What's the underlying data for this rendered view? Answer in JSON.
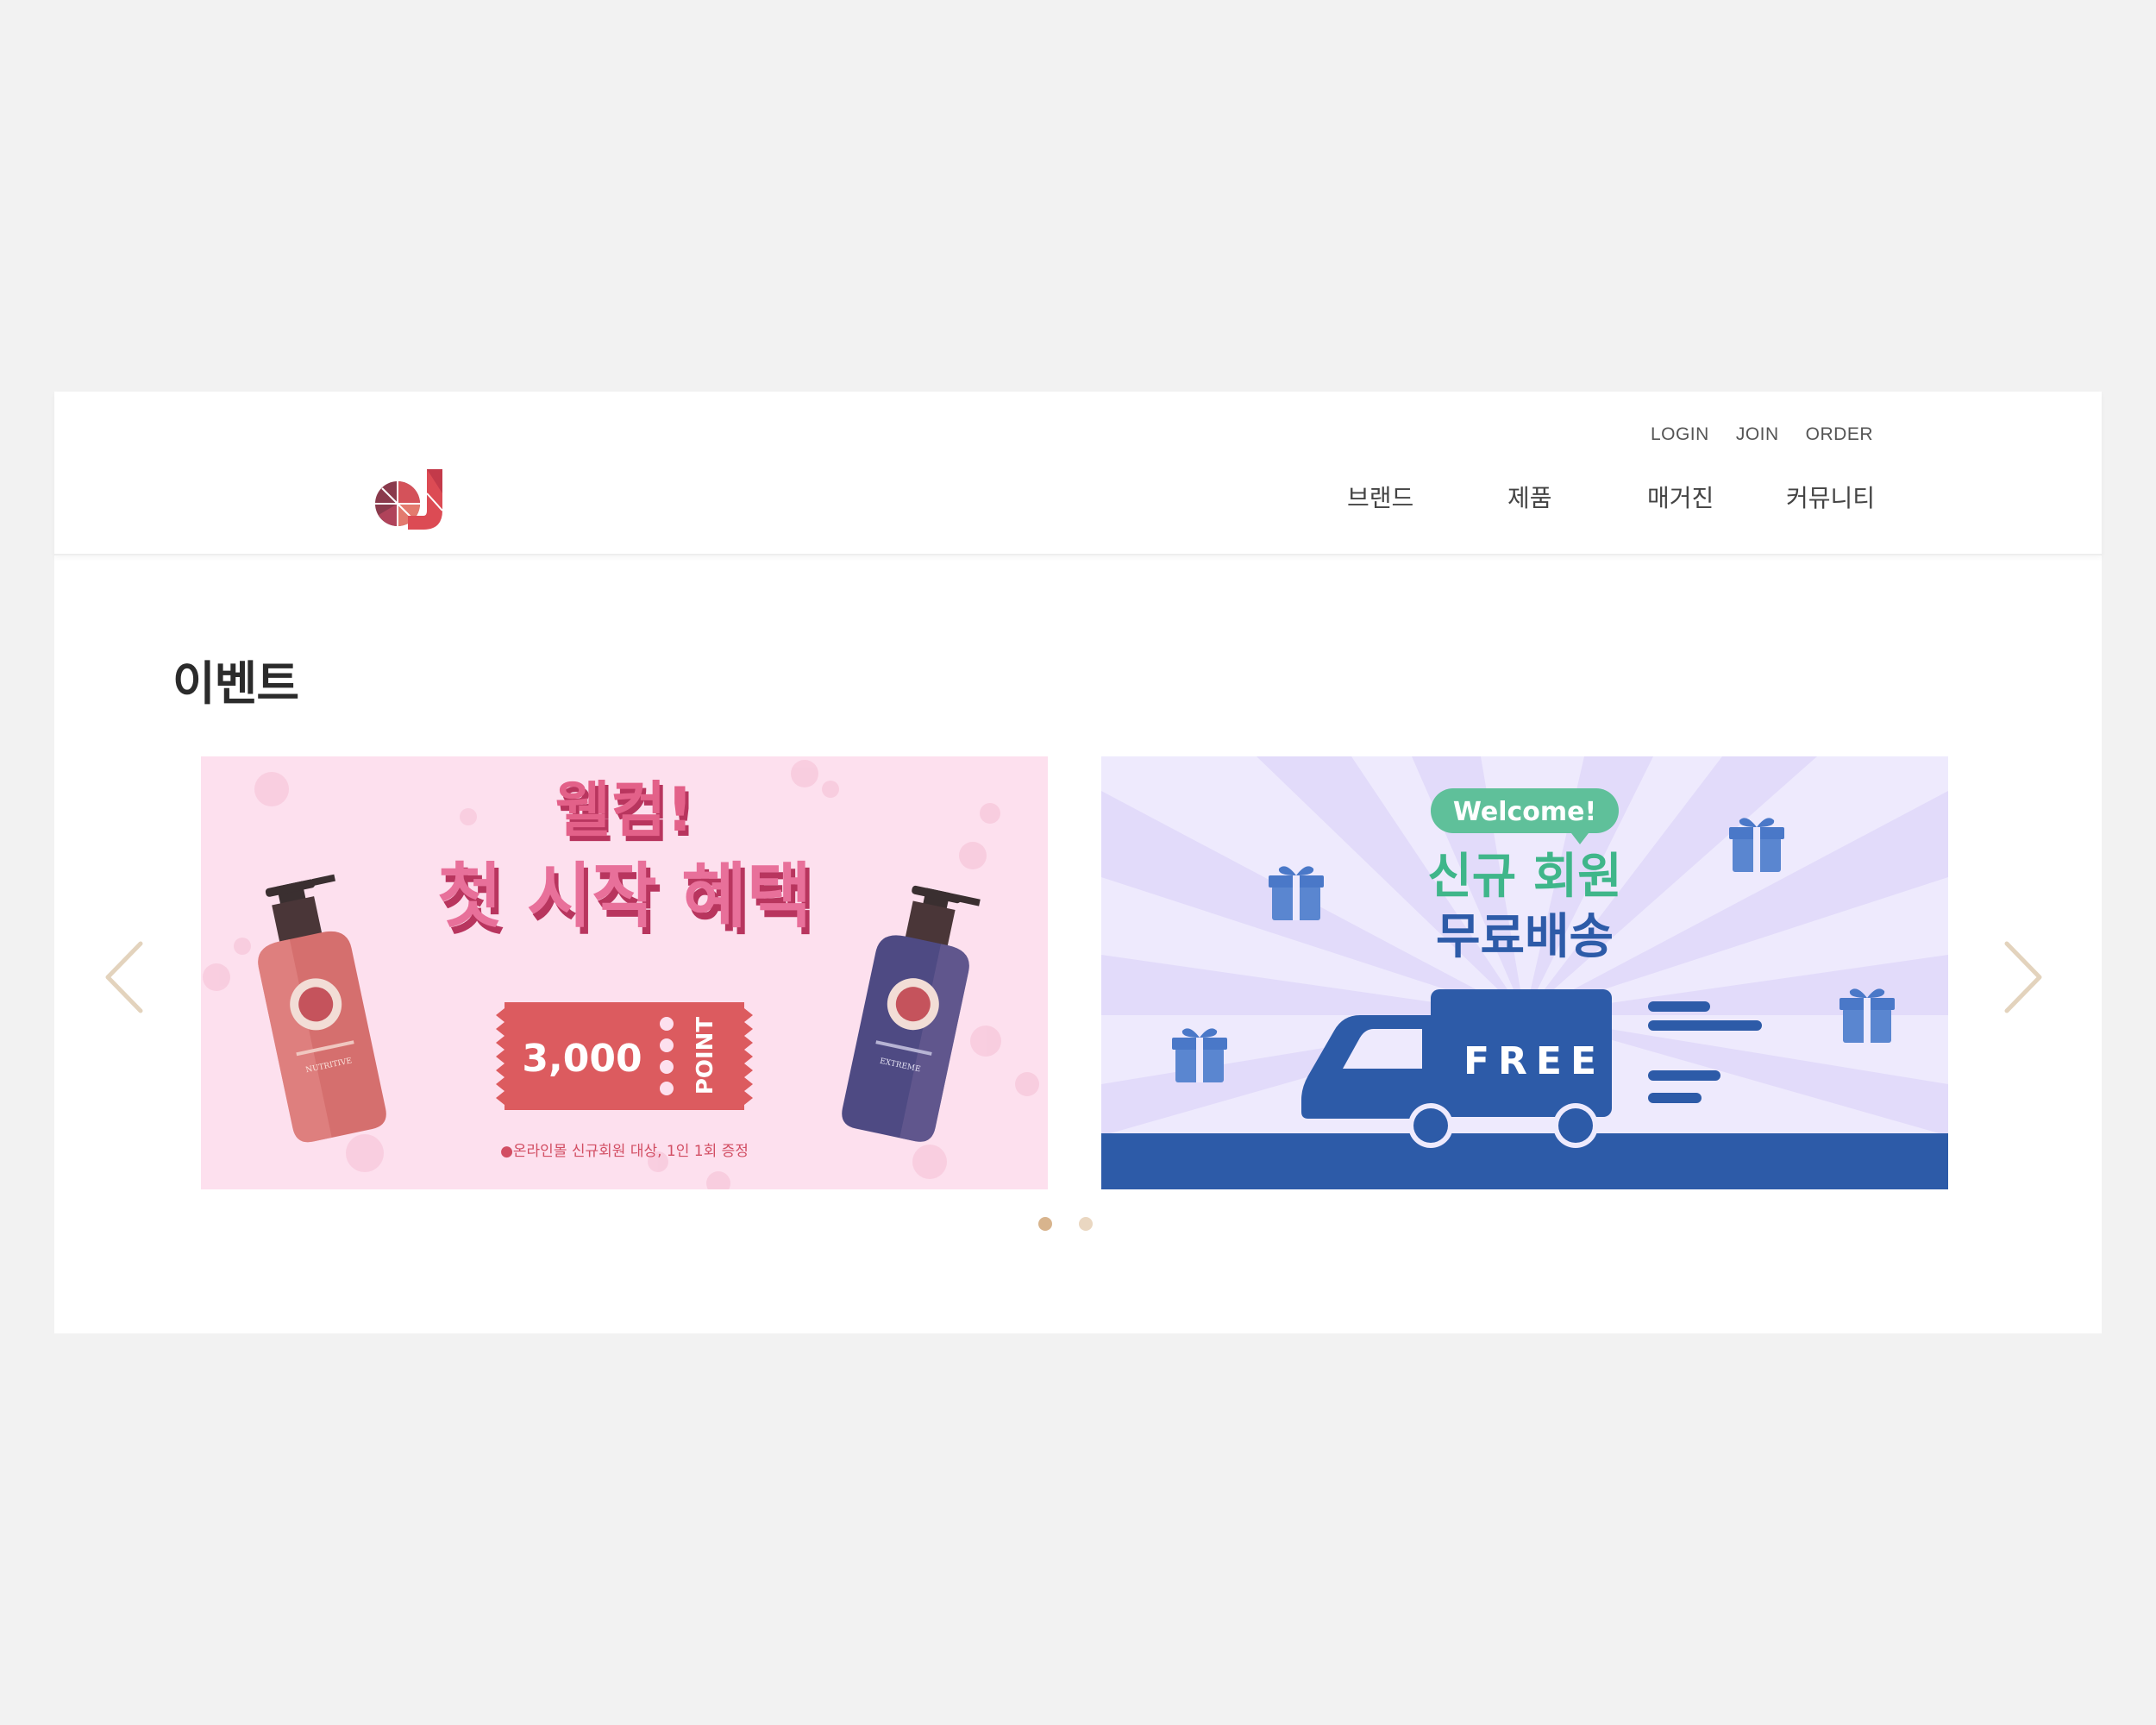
{
  "header": {
    "logo_alt": "brand logo",
    "util_links": [
      "LOGIN",
      "JOIN",
      "ORDER"
    ],
    "main_menu": [
      "브랜드",
      "제품",
      "매거진",
      "커뮤니티"
    ]
  },
  "event": {
    "title": "이벤트",
    "banners": [
      {
        "headline_1": "웰컴!",
        "headline_2": "첫 시작 혜택",
        "coupon_value": "3,000",
        "coupon_unit": "POINT",
        "footnote": "●온라인몰 신규회원 대상, 1인 1회 증정",
        "product_left": "NUTRITIVE",
        "product_right": "EXTREME",
        "colors": {
          "bg": "#fde0ee",
          "headline": "#e0557e",
          "coupon": "#dc5b5f"
        }
      },
      {
        "badge": "Welcome!",
        "headline_1": "신규 회원",
        "headline_2": "무료배송",
        "truck_text": "FREE",
        "colors": {
          "bg": "#eeeafd",
          "badge": "#5fc09a",
          "headline_1": "#3fb68a",
          "truck": "#2d5ba8"
        }
      }
    ],
    "pager_active": 1,
    "pager_count": 2
  },
  "colors": {
    "page_bg": "#f2f2f2",
    "arrow": "#e3d3bd",
    "dot_active": "#d8b48d",
    "dot_inactive": "#ead7c1"
  }
}
